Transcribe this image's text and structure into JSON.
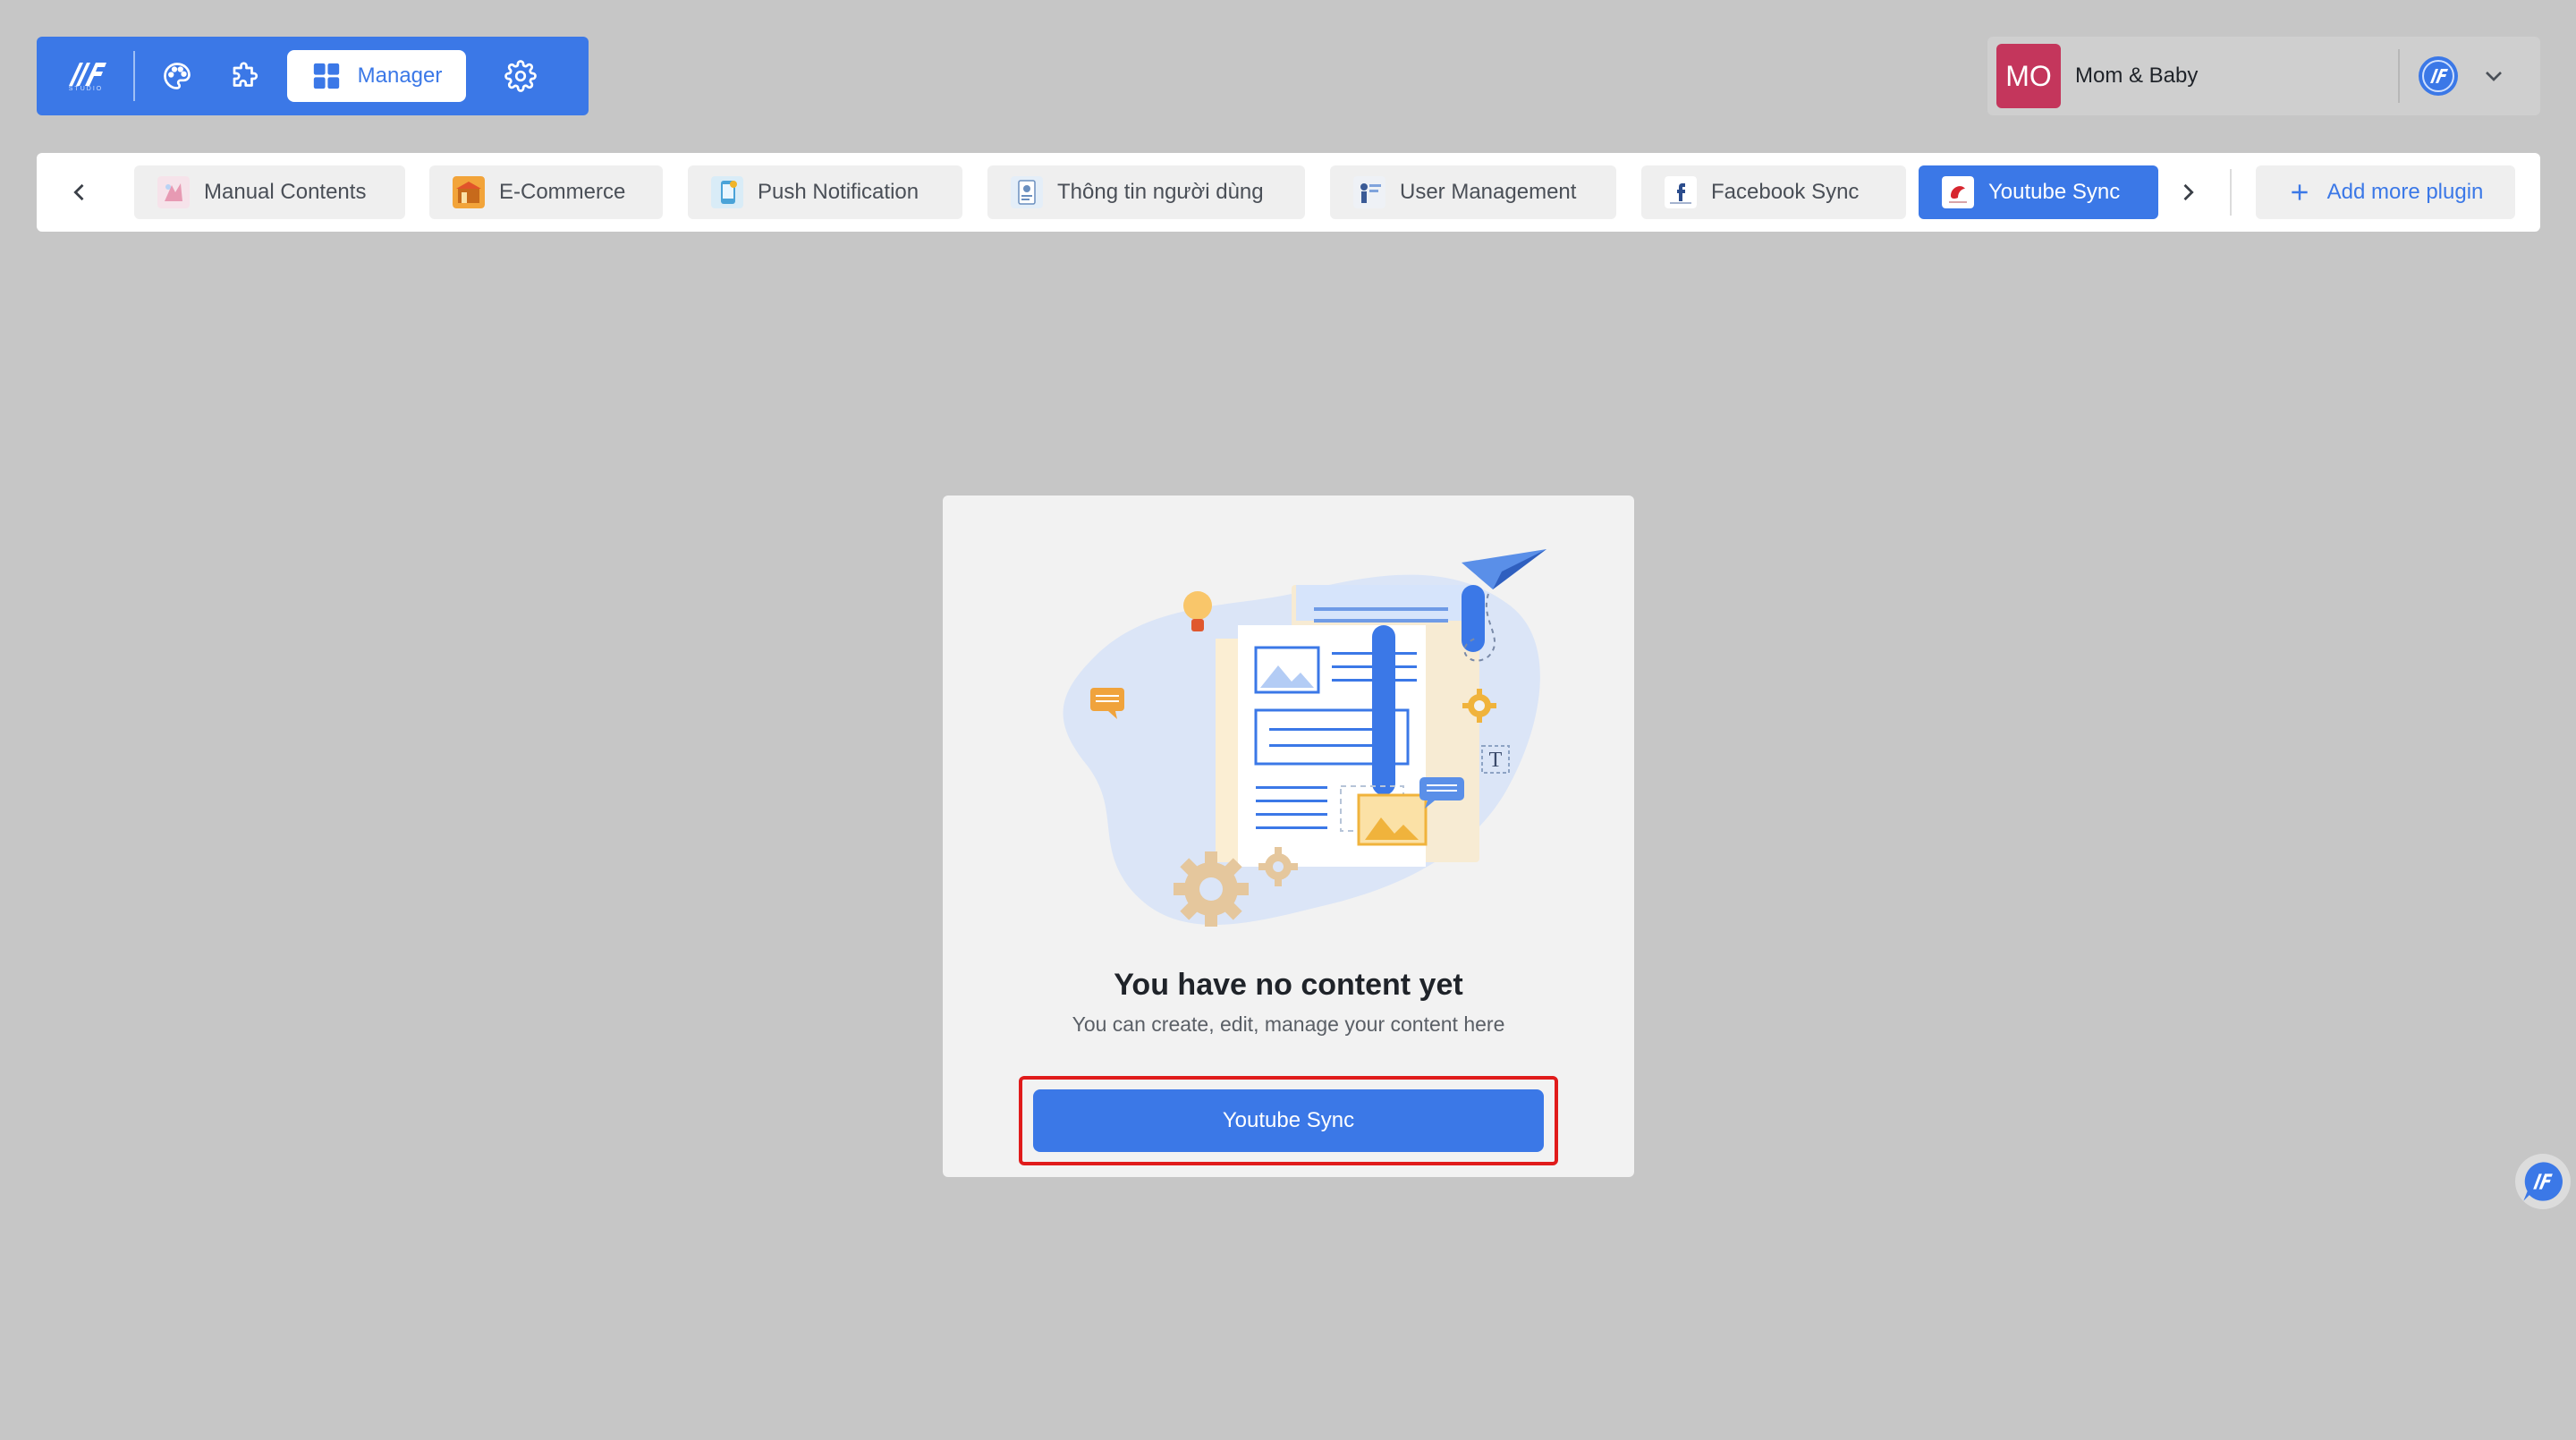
{
  "toolbar": {
    "logo_icon": "studio-logo-icon",
    "logo_sub": "STUDIO",
    "theme_icon": "palette-icon",
    "plugin_icon": "puzzle-icon",
    "manager_icon": "grid-icon",
    "manager_label": "Manager",
    "settings_icon": "gear-icon",
    "accent": "#3b78e7"
  },
  "app_switcher": {
    "avatar_initials": "MO",
    "avatar_color": "#c4365c",
    "app_name": "Mom & Baby",
    "logo_icon": "studio-round-logo-icon",
    "chevron_icon": "chevron-down-icon"
  },
  "tabs": {
    "prev_icon": "chevron-left-icon",
    "next_icon": "chevron-right-icon",
    "items": [
      {
        "label": "Manual Contents",
        "active": false
      },
      {
        "label": "E-Commerce",
        "active": false
      },
      {
        "label": "Push Notification",
        "active": false
      },
      {
        "label": "Thông tin người dùng",
        "active": false
      },
      {
        "label": "User Management",
        "active": false
      },
      {
        "label": "Facebook Sync",
        "active": false
      },
      {
        "label": "Youtube Sync",
        "active": true
      }
    ],
    "add_plugin_label": "Add more plugin",
    "add_icon": "plus-icon"
  },
  "empty_state": {
    "illustration": "documents-illustration",
    "title": "You have no content yet",
    "subtitle": "You can create, edit, manage your content here",
    "button_label": "Youtube Sync",
    "highlight_color": "#e01b1b"
  },
  "fab": {
    "icon": "chat-support-icon"
  }
}
